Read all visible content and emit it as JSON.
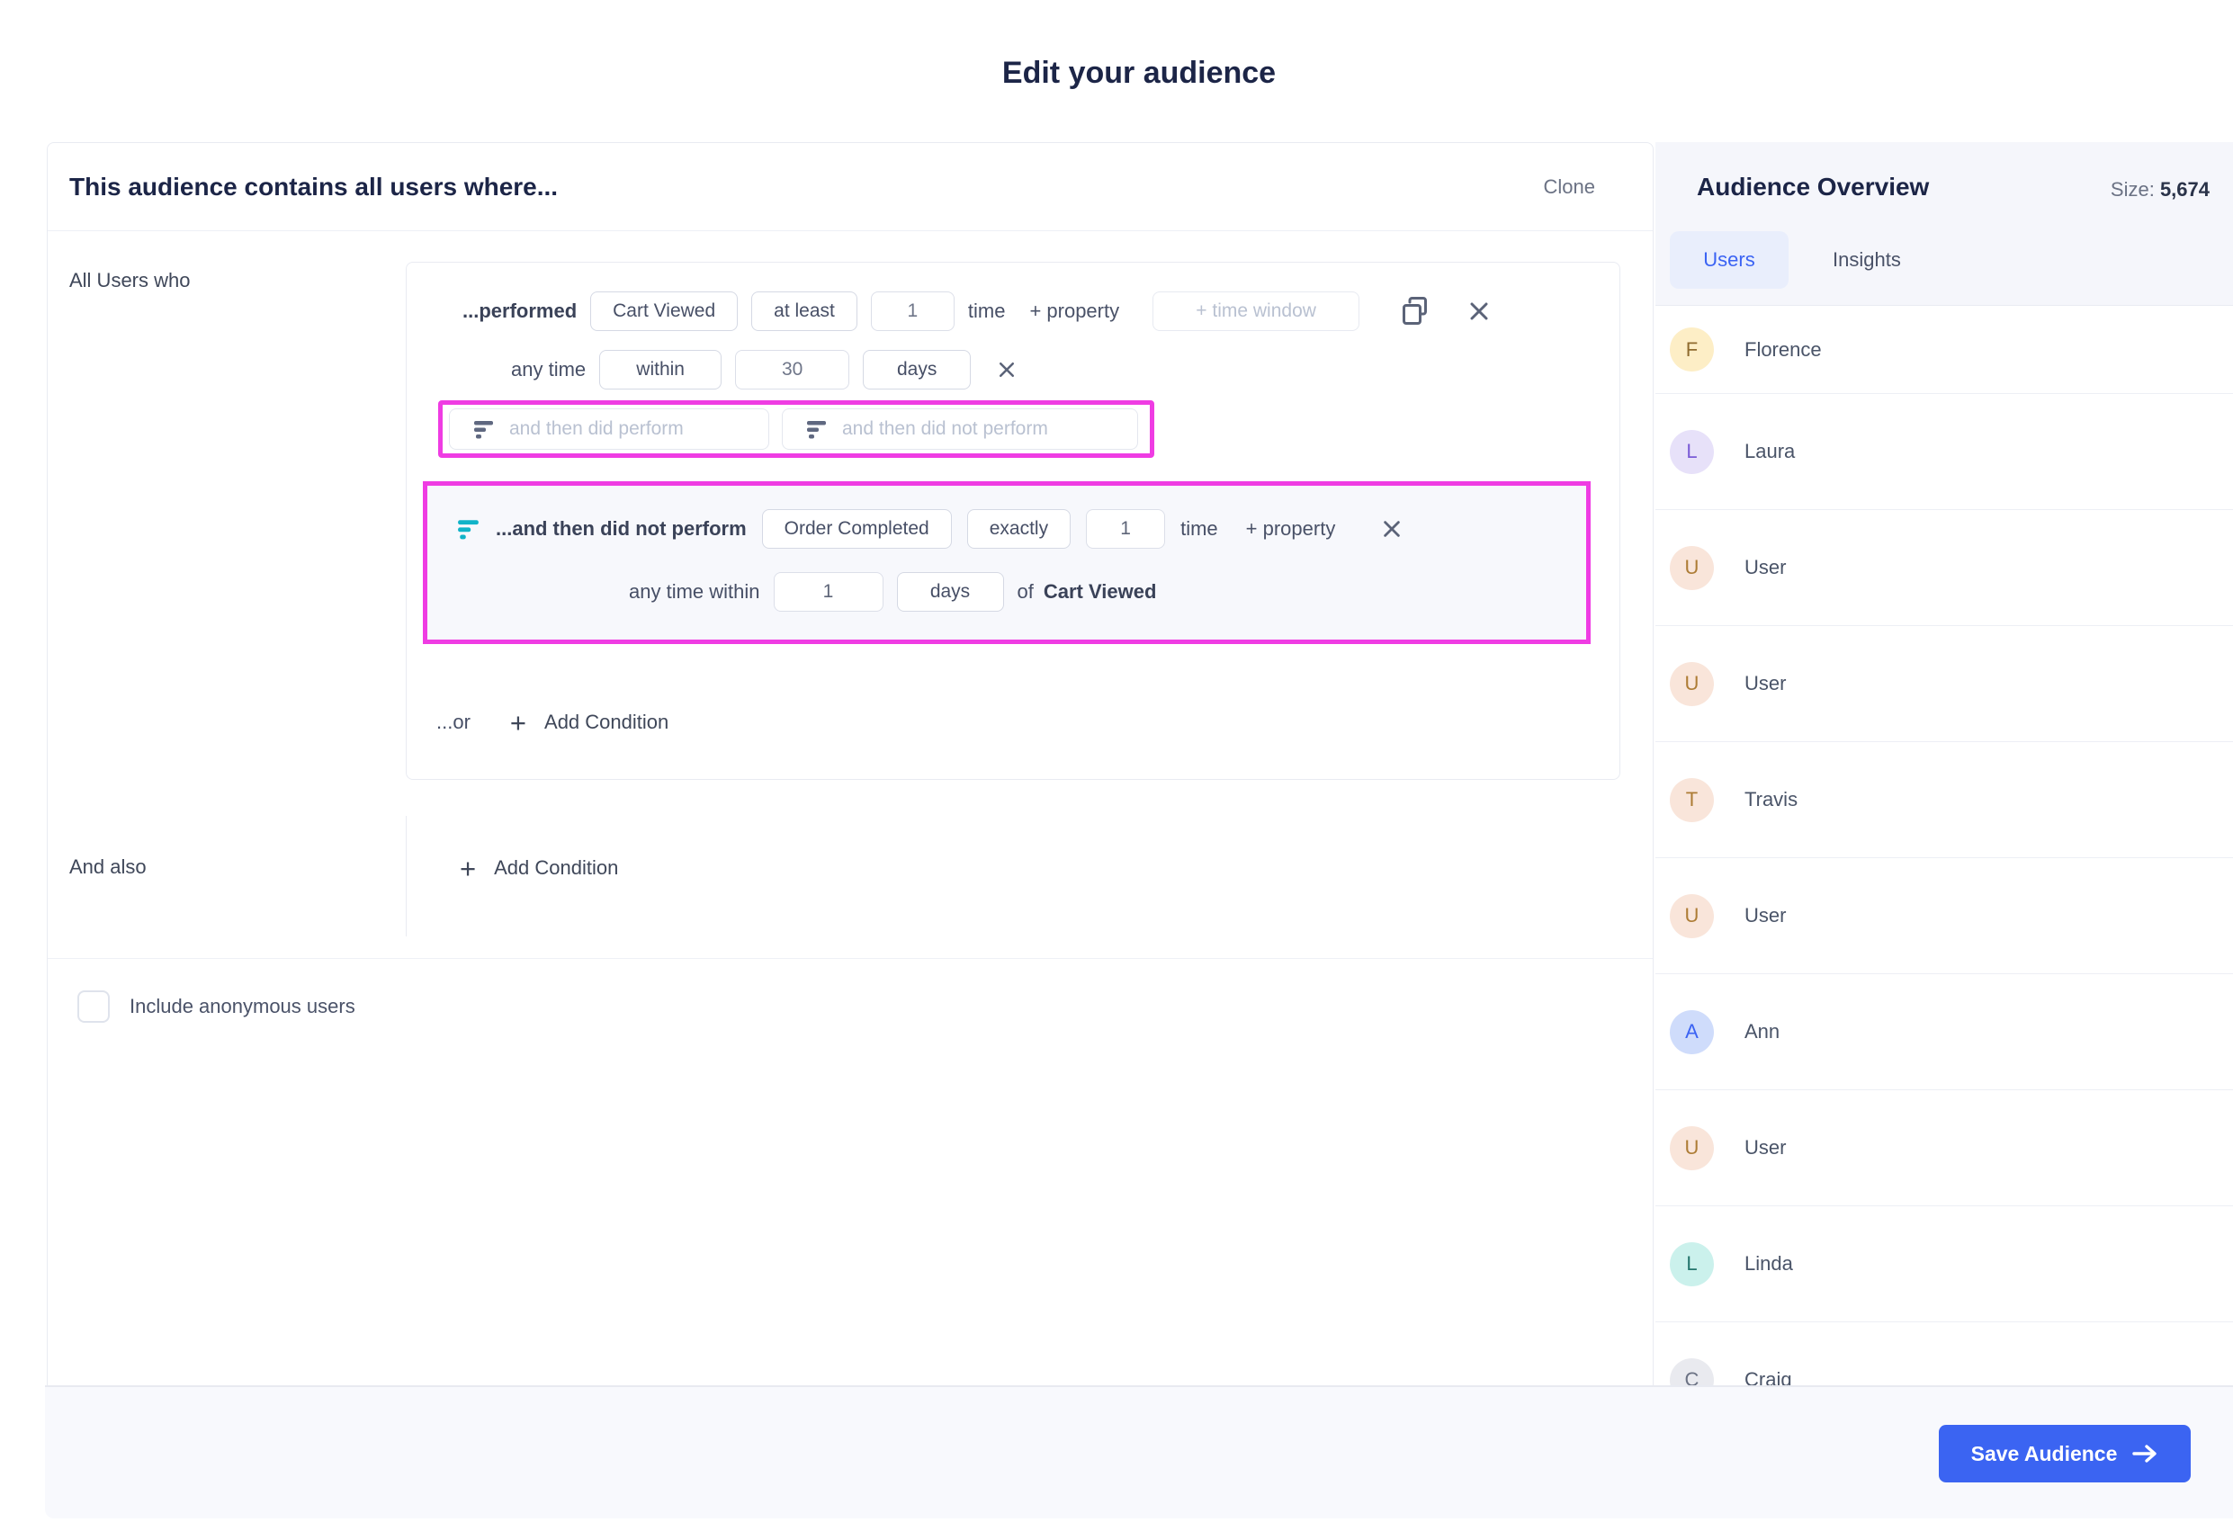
{
  "page": {
    "title": "Edit your audience"
  },
  "builder": {
    "header": {
      "title": "This audience contains all users where...",
      "clone_label": "Clone"
    },
    "group_label": "All Users who",
    "condition1": {
      "prefix": "...performed",
      "event": "Cart Viewed",
      "operator": "at least",
      "count": "1",
      "count_suffix": "time",
      "add_property_label": "+ property",
      "time_window_placeholder": "+ time window",
      "time_row": {
        "prefix": "any time",
        "operator": "within",
        "value": "30",
        "unit": "days"
      }
    },
    "sequence_buttons": {
      "did_perform": "and then did perform",
      "did_not_perform": "and then did not perform"
    },
    "condition2": {
      "prefix": "...and then did not perform",
      "event": "Order Completed",
      "operator": "exactly",
      "count": "1",
      "count_suffix": "time",
      "add_property_label": "+ property",
      "time_row": {
        "prefix": "any time within",
        "value": "1",
        "unit": "days",
        "of_label": "of",
        "ref_event": "Cart Viewed"
      }
    },
    "or_label": "...or",
    "add_condition_label": "Add Condition",
    "and_also_label": "And also",
    "anonymous_checkbox_label": "Include anonymous users"
  },
  "sidebar": {
    "title": "Audience Overview",
    "size_label": "Size:",
    "size_value": "5,674",
    "tabs": {
      "users": "Users",
      "insights": "Insights"
    },
    "users": [
      {
        "initial": "F",
        "name": "Florence",
        "bg": "#fdeec6",
        "fg": "#8f6b2e"
      },
      {
        "initial": "L",
        "name": "Laura",
        "bg": "#e7e1f9",
        "fg": "#7a5bd6"
      },
      {
        "initial": "U",
        "name": "User",
        "bg": "#f9e5da",
        "fg": "#ad7c35"
      },
      {
        "initial": "U",
        "name": "User",
        "bg": "#f9e5da",
        "fg": "#ad7c35"
      },
      {
        "initial": "T",
        "name": "Travis",
        "bg": "#f9e5da",
        "fg": "#ad7c35"
      },
      {
        "initial": "U",
        "name": "User",
        "bg": "#f9e5da",
        "fg": "#ad7c35"
      },
      {
        "initial": "A",
        "name": "Ann",
        "bg": "#cfdcfb",
        "fg": "#3b63f3"
      },
      {
        "initial": "U",
        "name": "User",
        "bg": "#f9e5da",
        "fg": "#ad7c35"
      },
      {
        "initial": "L",
        "name": "Linda",
        "bg": "#cbf1ec",
        "fg": "#23756c"
      },
      {
        "initial": "C",
        "name": "Craig",
        "bg": "#e9eaef",
        "fg": "#6b7284"
      }
    ]
  },
  "footer": {
    "save_label": "Save Audience"
  },
  "colors": {
    "accent_blue": "#3b64f2",
    "highlight_magenta": "#ef3ce3",
    "funnel_teal": "#10b3c8",
    "heading_navy": "#1c2547"
  }
}
